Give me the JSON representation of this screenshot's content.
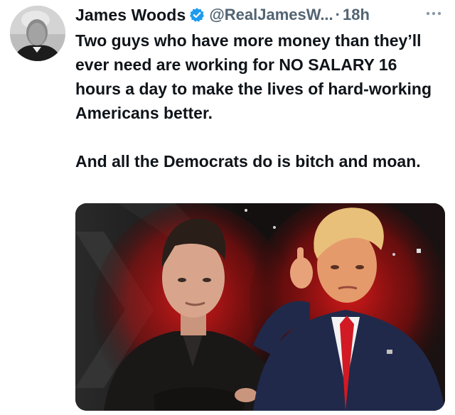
{
  "tweet": {
    "author_name": "James Woods",
    "handle": "@RealJamesW...",
    "separator": "·",
    "time": "18h",
    "text": "Two guys who have more money than they’ll ever need are working for NO SALARY 16 hours a day to make the lives of hard-working Americans better.\n\nAnd all the Democrats do is bitch and moan.",
    "verified": true,
    "icons": {
      "verified": "verified-badge-icon",
      "more": "more-options-icon"
    },
    "colors": {
      "verified_blue": "#1d9bf0",
      "secondary_text": "#536471",
      "primary_text": "#0f1419",
      "image_glow": "#e01a1a"
    }
  }
}
